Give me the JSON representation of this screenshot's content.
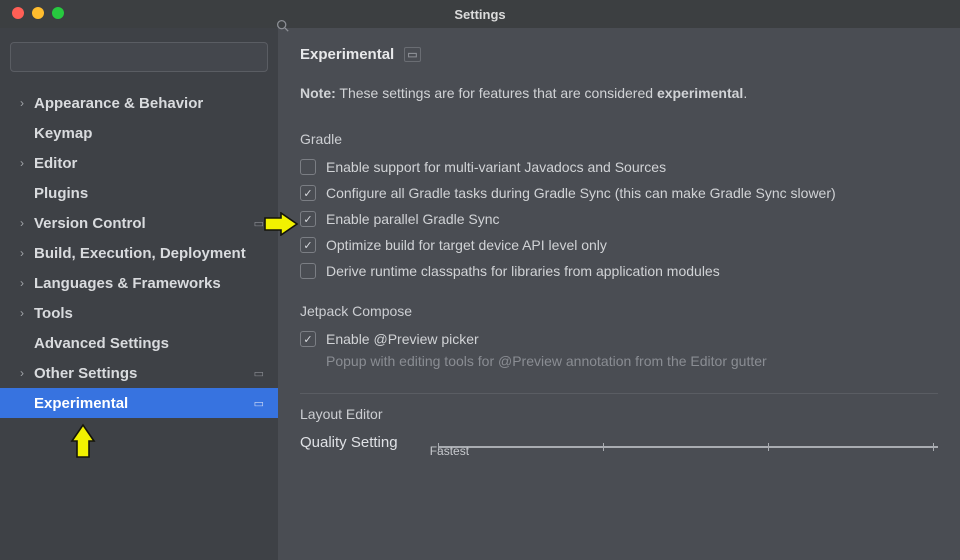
{
  "window": {
    "title": "Settings"
  },
  "search": {
    "placeholder": ""
  },
  "sidebar": [
    {
      "label": "Appearance & Behavior",
      "expandable": true,
      "bold": true
    },
    {
      "label": "Keymap",
      "expandable": false,
      "bold": true
    },
    {
      "label": "Editor",
      "expandable": true,
      "bold": true
    },
    {
      "label": "Plugins",
      "expandable": false,
      "bold": true
    },
    {
      "label": "Version Control",
      "expandable": true,
      "bold": true,
      "badge": true
    },
    {
      "label": "Build, Execution, Deployment",
      "expandable": true,
      "bold": true
    },
    {
      "label": "Languages & Frameworks",
      "expandable": true,
      "bold": true
    },
    {
      "label": "Tools",
      "expandable": true,
      "bold": true
    },
    {
      "label": "Advanced Settings",
      "expandable": false,
      "bold": true
    },
    {
      "label": "Other Settings",
      "expandable": true,
      "bold": true,
      "badge": true
    },
    {
      "label": "Experimental",
      "expandable": false,
      "bold": true,
      "badge": true,
      "selected": true,
      "indent": true
    }
  ],
  "page": {
    "title": "Experimental",
    "note_prefix": "Note:",
    "note_body": " These settings are for features that are considered ",
    "note_bold": "experimental",
    "note_suffix": "."
  },
  "gradle": {
    "title": "Gradle",
    "options": [
      {
        "label": "Enable support for multi-variant Javadocs and Sources",
        "checked": false
      },
      {
        "label": "Configure all Gradle tasks during Gradle Sync (this can make Gradle Sync slower)",
        "checked": true
      },
      {
        "label": "Enable parallel Gradle Sync",
        "checked": true
      },
      {
        "label": "Optimize build for target device API level only",
        "checked": true
      },
      {
        "label": "Derive runtime classpaths for libraries from application modules",
        "checked": false
      }
    ]
  },
  "jetpack": {
    "title": "Jetpack Compose",
    "option": {
      "label": "Enable @Preview picker",
      "checked": true
    },
    "hint": "Popup with editing tools for @Preview annotation from the Editor gutter"
  },
  "layout_editor": {
    "title": "Layout Editor",
    "quality_label": "Quality Setting",
    "slider_fastest": "Fastest"
  }
}
